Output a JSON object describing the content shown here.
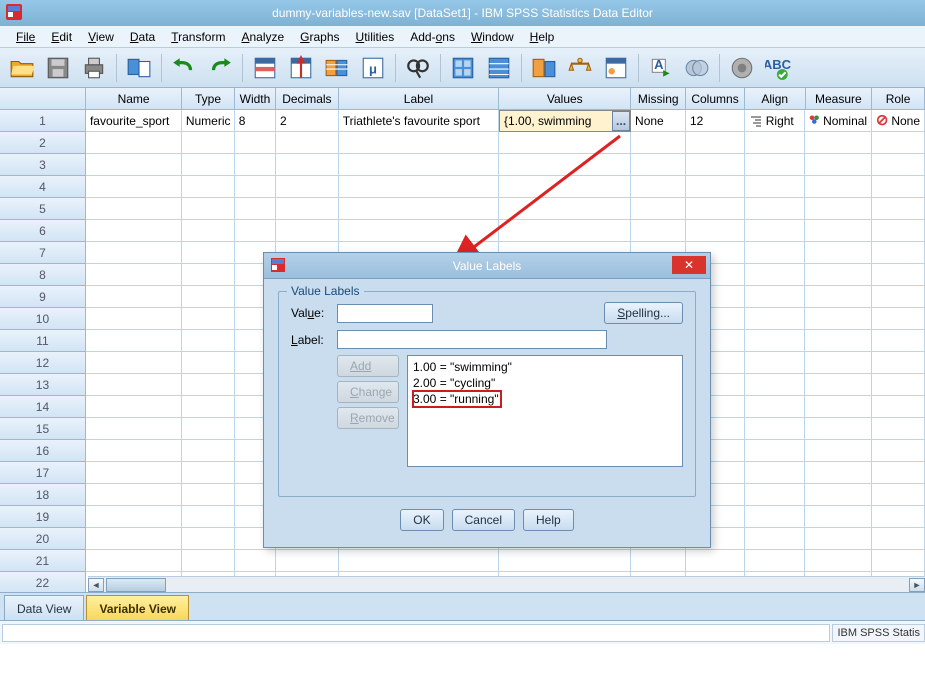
{
  "window": {
    "title": "dummy-variables-new.sav [DataSet1] - IBM SPSS Statistics Data Editor"
  },
  "menu": [
    "File",
    "Edit",
    "View",
    "Data",
    "Transform",
    "Analyze",
    "Graphs",
    "Utilities",
    "Add-ons",
    "Window",
    "Help"
  ],
  "columns": {
    "name": "Name",
    "type": "Type",
    "width": "Width",
    "decimals": "Decimals",
    "label": "Label",
    "values": "Values",
    "missing": "Missing",
    "columns": "Columns",
    "align": "Align",
    "measure": "Measure",
    "role": "Role"
  },
  "rows": {
    "labels": [
      "1",
      "2",
      "3",
      "4",
      "5",
      "6",
      "7",
      "8",
      "9",
      "10",
      "11",
      "12",
      "13",
      "14",
      "15",
      "16",
      "17",
      "18",
      "19",
      "20",
      "21",
      "22"
    ]
  },
  "var1": {
    "name": "favourite_sport",
    "type": "Numeric",
    "width": "8",
    "decimals": "2",
    "label": "Triathlete's favourite sport",
    "values": "{1.00, swimming",
    "missing": "None",
    "columns": "12",
    "align": "Right",
    "measure": "Nominal",
    "role": "None"
  },
  "tabs": {
    "data": "Data View",
    "variable": "Variable View"
  },
  "status": {
    "right": "IBM SPSS Statis"
  },
  "dialog": {
    "title": "Value Labels",
    "legend": "Value Labels",
    "value_label": "Value:",
    "label_label": "Label:",
    "spelling": "Spelling...",
    "add": "Add",
    "change": "Change",
    "remove": "Remove",
    "items": {
      "i0": "1.00 = \"swimming\"",
      "i1": "2.00 = \"cycling\"",
      "i2": "3.00 = \"running\""
    },
    "ok": "OK",
    "cancel": "Cancel",
    "help": "Help"
  }
}
